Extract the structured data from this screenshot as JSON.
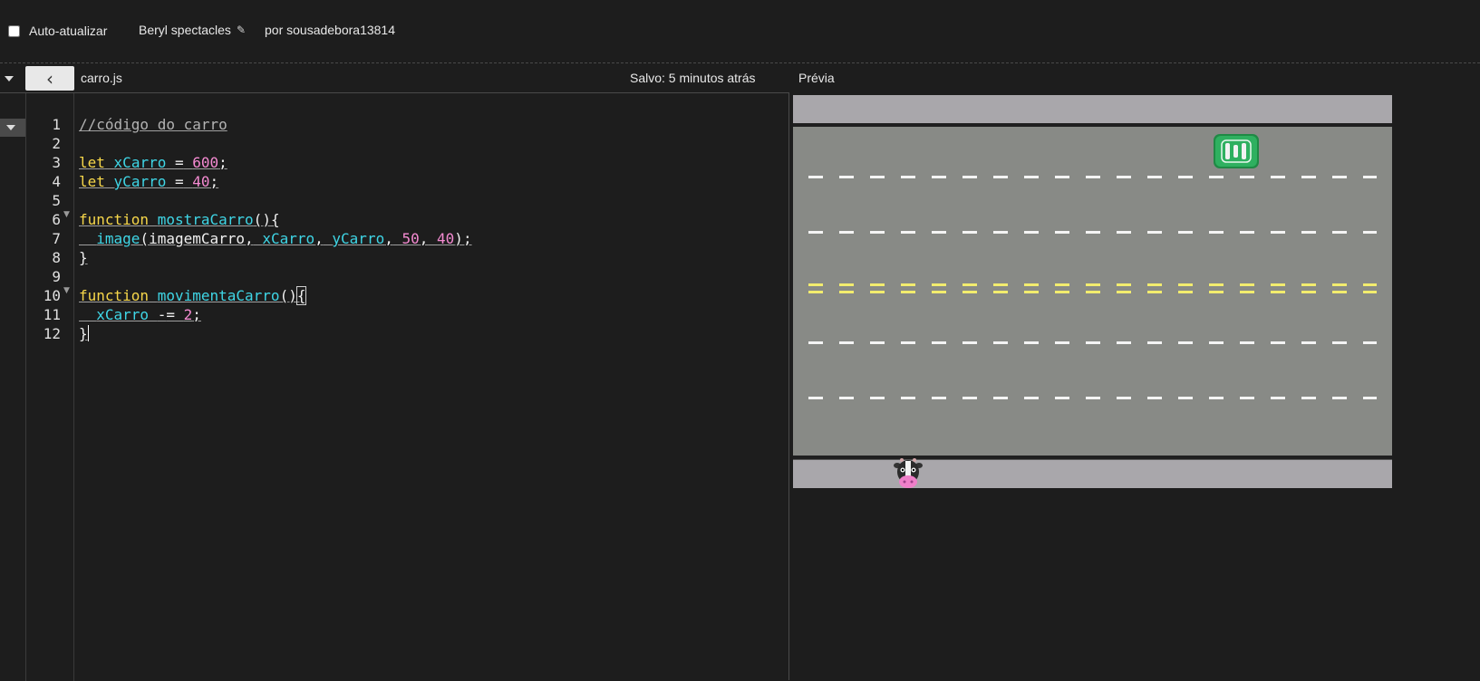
{
  "topbar": {
    "auto_refresh_label": "Auto-atualizar",
    "auto_refresh_checked": false,
    "project_title": "Beryl spectacles",
    "author": "por sousadebora13814"
  },
  "editor": {
    "filename": "carro.js",
    "saved_status": "Salvo: 5 minutos atrás",
    "line_numbers": [
      "1",
      "2",
      "3",
      "4",
      "5",
      "6",
      "7",
      "8",
      "9",
      "10",
      "11",
      "12"
    ],
    "code_lines": [
      "//código do carro",
      "",
      "let xCarro = 600;",
      "let yCarro = 40;",
      "",
      "function mostraCarro(){",
      "  image(imagemCarro, xCarro, yCarro, 50, 40);",
      "}",
      "",
      "function movimentaCarro(){",
      "  xCarro -= 2;",
      "}"
    ]
  },
  "preview": {
    "label": "Prévia",
    "colors": {
      "sidewalk": "#a9a7ab",
      "road": "#888a86",
      "lane_white": "#f4f4f4",
      "lane_yellow": "#f2ec6e",
      "car": "#2fb060"
    },
    "sprites": [
      "green-car-sprite",
      "cow-sprite"
    ]
  },
  "icons": {
    "collapse": "chevron-down-icon",
    "back": "chevron-left-icon",
    "edit": "pencil-icon"
  }
}
